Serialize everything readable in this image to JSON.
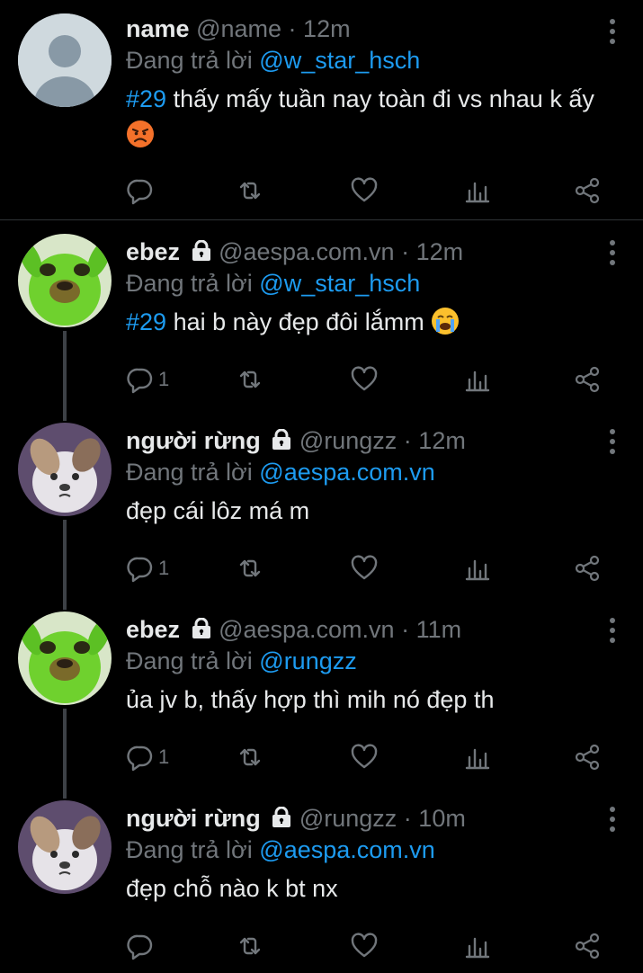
{
  "reply_prefix": "Đang trả lời",
  "tweets": [
    {
      "display_name": "name",
      "handle": "@name",
      "dot": "·",
      "time": "12m",
      "reply_to": "@w_star_hsch",
      "hashtag": "#29",
      "text": " thấy mấy tuần nay toàn đi vs nhau k ấy",
      "emoji": "pouting-face",
      "avatar": "default-avatar",
      "reply_count": "",
      "locked": false
    },
    {
      "display_name": "ebez",
      "handle": "@aespa.com.vn",
      "dot": "·",
      "time": "12m",
      "reply_to": "@w_star_hsch",
      "hashtag": "#29",
      "text": " hai b này đẹp đôi lắmm",
      "emoji": "loudly-crying-face",
      "avatar": "green-dog-avatar",
      "reply_count": "1",
      "locked": true
    },
    {
      "display_name": "người rừng",
      "handle": "@rungzz",
      "dot": "·",
      "time": "12m",
      "reply_to": "@aespa.com.vn",
      "hashtag": "",
      "text": "đẹp cái lôz má m",
      "emoji": "",
      "avatar": "sad-puppy-avatar",
      "reply_count": "1",
      "locked": true
    },
    {
      "display_name": "ebez",
      "handle": "@aespa.com.vn",
      "dot": "·",
      "time": "11m",
      "reply_to": "@rungzz",
      "hashtag": "",
      "text": "ủa jv b, thấy hợp thì mih nó đẹp th",
      "emoji": "",
      "avatar": "green-dog-avatar",
      "reply_count": "1",
      "locked": true
    },
    {
      "display_name": "người rừng",
      "handle": "@rungzz",
      "dot": "·",
      "time": "10m",
      "reply_to": "@aespa.com.vn",
      "hashtag": "",
      "text": "đẹp chỗ nào k bt nx",
      "emoji": "",
      "avatar": "sad-puppy-avatar",
      "reply_count": "",
      "locked": true
    }
  ],
  "colors": {
    "background": "#000000",
    "accent": "#1d9bf0",
    "muted": "#71767b",
    "text": "#e7e9ea"
  }
}
